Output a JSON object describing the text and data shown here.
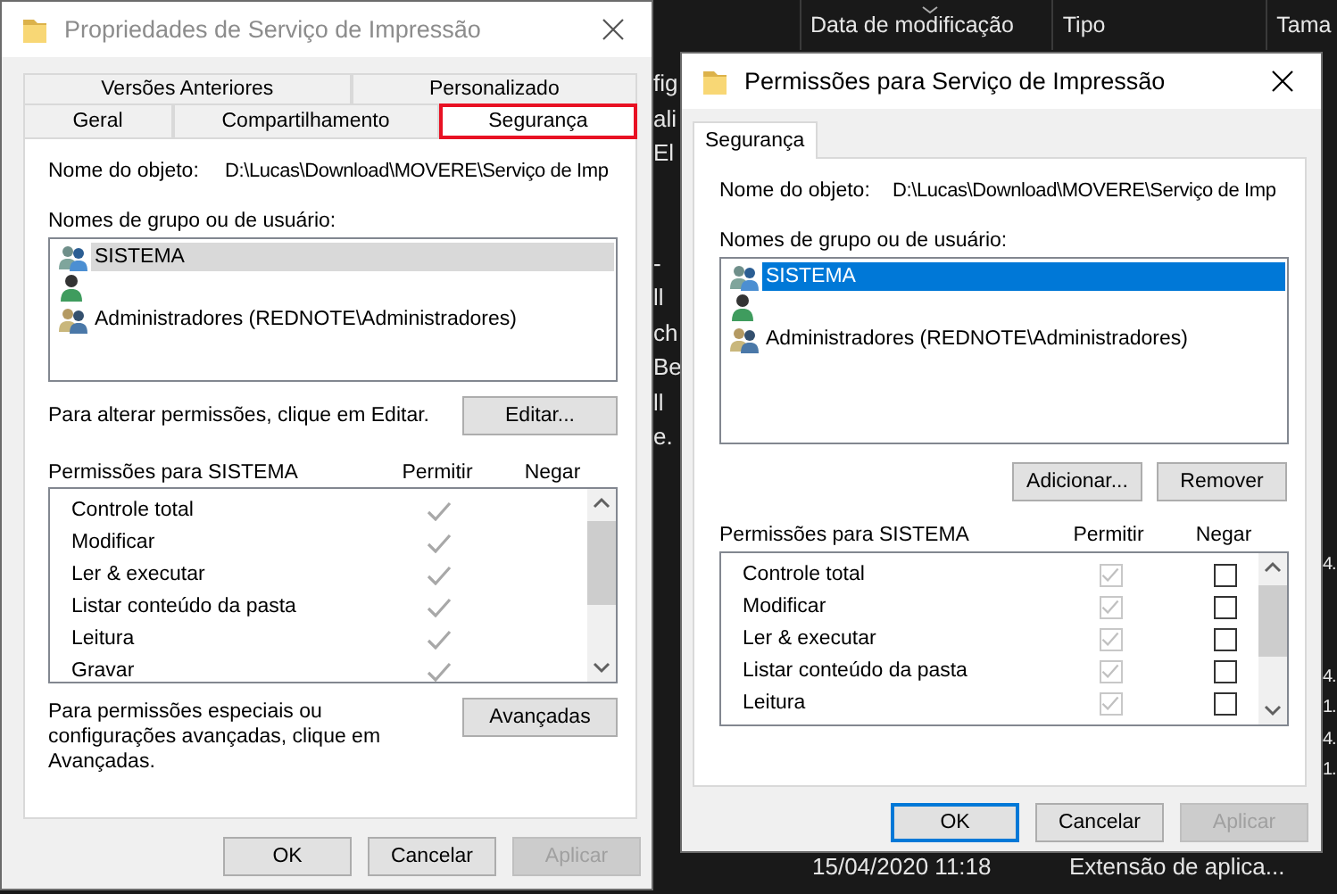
{
  "explorer": {
    "columns": [
      "Data de modificação",
      "Tipo",
      "Tama"
    ],
    "left_fragments": [
      [
        "fig",
        "ali",
        "El"
      ],
      [
        "-",
        "ll",
        "ch",
        "Be",
        "ll",
        "e."
      ]
    ],
    "right_fragments": [
      [
        "4."
      ],
      [
        "4.",
        "1.",
        "4.",
        "1."
      ]
    ],
    "rows": [
      {
        "date": "15/04/2020 11:18",
        "type": "Extensão de aplica..."
      }
    ]
  },
  "properties_window": {
    "title": "Propriedades de Serviço de Impressão",
    "focused": false,
    "tab_rows": [
      [
        {
          "label": "Versões Anteriores",
          "selected": false,
          "highlighted": false
        },
        {
          "label": "Personalizado",
          "selected": false,
          "highlighted": false
        }
      ],
      [
        {
          "label": "Geral",
          "selected": false,
          "highlighted": false
        },
        {
          "label": "Compartilhamento",
          "selected": false,
          "highlighted": false
        },
        {
          "label": "Segurança",
          "selected": true,
          "highlighted": true
        }
      ]
    ],
    "object_label": "Nome do objeto:",
    "object_name": "D:\\Lucas\\Download\\MOVERE\\Serviço de Imp",
    "users_label": "Nomes de grupo ou de usuário:",
    "users": [
      {
        "name": "SISTEMA",
        "kind": "group",
        "selected": true
      },
      {
        "kind": "user",
        "selected": false
      },
      {
        "name": "Administradores (REDNOTE\\Administradores)",
        "kind": "admins",
        "selected": false
      }
    ],
    "edit_hint": "Para alterar permissões, clique em Editar.",
    "edit_button": "Editar...",
    "permissions_label": "Permissões para SISTEMA",
    "allow_header": "Permitir",
    "deny_header": "Negar",
    "permissions": [
      {
        "name": "Controle total",
        "allow": true,
        "deny": false
      },
      {
        "name": "Modificar",
        "allow": true,
        "deny": false
      },
      {
        "name": "Ler & executar",
        "allow": true,
        "deny": false
      },
      {
        "name": "Listar conteúdo da pasta",
        "allow": true,
        "deny": false
      },
      {
        "name": "Leitura",
        "allow": true,
        "deny": false
      },
      {
        "name": "Gravar",
        "allow": true,
        "deny": false
      }
    ],
    "advanced_hint": "Para permissões especiais ou configurações avançadas, clique em Avançadas.",
    "advanced_button": "Avançadas",
    "buttons": [
      {
        "label": "OK",
        "default": false,
        "disabled": false
      },
      {
        "label": "Cancelar",
        "default": false,
        "disabled": false
      },
      {
        "label": "Aplicar",
        "default": false,
        "disabled": true
      }
    ]
  },
  "permissions_window": {
    "title": "Permissões para Serviço de Impressão",
    "focused": true,
    "tabs": [
      {
        "label": "Segurança",
        "selected": true
      }
    ],
    "object_label": "Nome do objeto:",
    "object_name": "D:\\Lucas\\Download\\MOVERE\\Serviço de Imp",
    "users_label": "Nomes de grupo ou de usuário:",
    "users": [
      {
        "name": "SISTEMA",
        "kind": "group",
        "selected": true
      },
      {
        "kind": "user",
        "selected": false
      },
      {
        "name": "Administradores (REDNOTE\\Administradores)",
        "kind": "admins",
        "selected": false
      }
    ],
    "add_button": "Adicionar...",
    "remove_button": "Remover",
    "permissions_label": "Permissões para SISTEMA",
    "allow_header": "Permitir",
    "deny_header": "Negar",
    "permissions": [
      {
        "name": "Controle total",
        "allow": true,
        "allow_disabled": true,
        "deny": false
      },
      {
        "name": "Modificar",
        "allow": true,
        "allow_disabled": true,
        "deny": false
      },
      {
        "name": "Ler & executar",
        "allow": true,
        "allow_disabled": true,
        "deny": false
      },
      {
        "name": "Listar conteúdo da pasta",
        "allow": true,
        "allow_disabled": true,
        "deny": false
      },
      {
        "name": "Leitura",
        "allow": true,
        "allow_disabled": true,
        "deny": false
      }
    ],
    "buttons": [
      {
        "label": "OK",
        "default": true,
        "disabled": false
      },
      {
        "label": "Cancelar",
        "default": false,
        "disabled": false
      },
      {
        "label": "Aplicar",
        "default": false,
        "disabled": true
      }
    ]
  }
}
